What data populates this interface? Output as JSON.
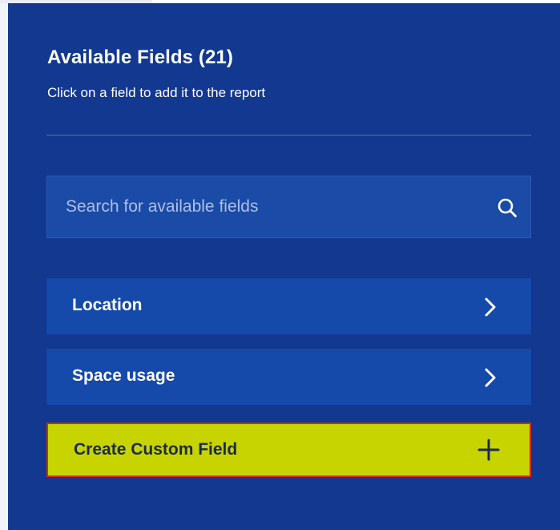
{
  "panel": {
    "title": "Available Fields (21)",
    "subtitle": "Click on a field to add it to the report"
  },
  "search": {
    "placeholder": "Search for available fields",
    "icon": "search-icon"
  },
  "groups": [
    {
      "label": "Location",
      "icon": "chevron-right-icon"
    },
    {
      "label": "Space usage",
      "icon": "chevron-right-icon"
    }
  ],
  "create": {
    "label": "Create Custom Field",
    "icon": "plus-icon"
  },
  "colors": {
    "panel_bg": "#12388f",
    "row_bg": "#1549aa",
    "create_bg": "#c8d400",
    "create_border": "#d8262a"
  }
}
